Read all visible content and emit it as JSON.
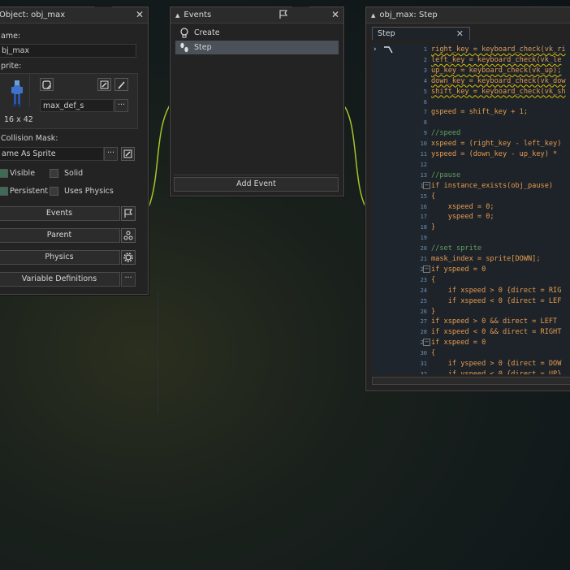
{
  "object_panel": {
    "title": "Object: obj_max",
    "name_label": "ame:",
    "name_value": "bj_max",
    "sprite_label": "prite:",
    "sprite_name": "max_def_s",
    "sprite_size": "16 x 42",
    "collision_label": "Collision Mask:",
    "collision_value": "ame As Sprite",
    "more_label": "···",
    "checkboxes": [
      {
        "label": "Visible",
        "checked": true
      },
      {
        "label": "Solid",
        "checked": false
      },
      {
        "label": "Persistent",
        "checked": true
      },
      {
        "label": "Uses Physics",
        "checked": false
      }
    ],
    "buttons": {
      "events": "Events",
      "parent": "Parent",
      "physics": "Physics",
      "variables": "Variable Definitions"
    }
  },
  "events_panel": {
    "title": "Events",
    "items": [
      {
        "label": "Create",
        "icon": "lightbulb-icon",
        "selected": false
      },
      {
        "label": "Step",
        "icon": "footsteps-icon",
        "selected": true
      }
    ],
    "add_event": "Add Event"
  },
  "code_panel": {
    "title": "obj_max: Step",
    "tab": "Step",
    "lines": [
      {
        "n": "1",
        "text": "right_key = keyboard_check(vk_ri"
      },
      {
        "n": "2",
        "text": "left_key = keyboard_check(vk_le"
      },
      {
        "n": "3",
        "text": "up_key = keyboard_check(vk_up);"
      },
      {
        "n": "4",
        "text": "down_key = keyboard_check(vk_dow"
      },
      {
        "n": "5",
        "text": "shift_key = keyboard_check(vk_sh"
      },
      {
        "n": "6",
        "text": ""
      },
      {
        "n": "7",
        "text": "gspeed = shift_key + 1;"
      },
      {
        "n": "8",
        "text": ""
      },
      {
        "n": "9",
        "text": "//speed"
      },
      {
        "n": "10",
        "text": "xspeed = (right_key - left_key)"
      },
      {
        "n": "11",
        "text": "yspeed = (down_key - up_key) *"
      },
      {
        "n": "12",
        "text": ""
      },
      {
        "n": "13",
        "text": "//pause"
      },
      {
        "n": "14",
        "text": "if instance_exists(obj_pause)"
      },
      {
        "n": "15",
        "text": "{"
      },
      {
        "n": "16",
        "text": "    xspeed = 0;"
      },
      {
        "n": "17",
        "text": "    yspeed = 0;"
      },
      {
        "n": "18",
        "text": "}"
      },
      {
        "n": "19",
        "text": ""
      },
      {
        "n": "20",
        "text": "//set sprite"
      },
      {
        "n": "21",
        "text": "mask_index = sprite[DOWN];"
      },
      {
        "n": "22",
        "text": "if yspeed = 0"
      },
      {
        "n": "23",
        "text": "{"
      },
      {
        "n": "24",
        "text": "    if xspeed > 0 {direct = RIG"
      },
      {
        "n": "25",
        "text": "    if xspeed < 0 {direct = LEF"
      },
      {
        "n": "26",
        "text": "}"
      },
      {
        "n": "27",
        "text": "if xspeed > 0 && direct = LEFT"
      },
      {
        "n": "28",
        "text": "if xspeed < 0 && direct = RIGHT"
      },
      {
        "n": "29",
        "text": "if xspeed = 0"
      },
      {
        "n": "30",
        "text": "{"
      },
      {
        "n": "31",
        "text": "    if yspeed > 0 {direct = DOW"
      },
      {
        "n": "32",
        "text": "    if yspeed < 0 {direct = UP}"
      }
    ]
  },
  "colors": {
    "panel_bg": "#232323",
    "code_bg": "#1e2329",
    "line_number": "#6a8fb8",
    "keyword": "#f0a055",
    "comment": "#5fa05f",
    "number": "#e36f6f",
    "selection": "#4a5158"
  }
}
